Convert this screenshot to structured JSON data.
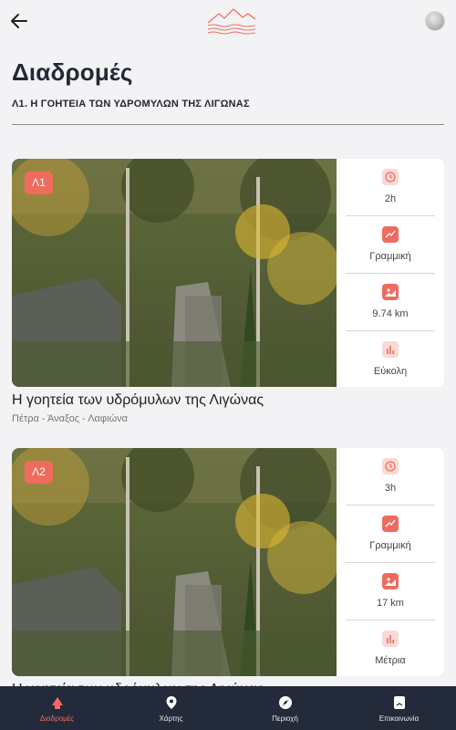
{
  "header": {
    "title": "Διαδρομές",
    "subtitle": "Λ1. Η ΓΟΗΤΕΙΑ ΤΩΝ ΥΔΡΟΜΥΛΩΝ ΤΗΣ ΛΙΓΩΝΑΣ"
  },
  "routes": [
    {
      "badge": "Λ1",
      "title": "Η γοητεία των υδρόμυλων της Λιγώνας",
      "places": "Πέτρα - Άναξος - Λαφιώνα",
      "stats": [
        {
          "icon": "clock-icon",
          "value": "2h"
        },
        {
          "icon": "trend-icon",
          "value": "Γραμμική"
        },
        {
          "icon": "image-icon",
          "value": "9.74 km"
        },
        {
          "icon": "chart-icon",
          "value": "Εύκολη"
        }
      ]
    },
    {
      "badge": "Λ2",
      "title": "Η γοητεία των υδρόμυλων της Λιγώνας",
      "places": "",
      "stats": [
        {
          "icon": "clock-icon",
          "value": "3h"
        },
        {
          "icon": "trend-icon",
          "value": "Γραμμική"
        },
        {
          "icon": "image-icon",
          "value": "17 km"
        },
        {
          "icon": "chart-icon",
          "value": "Μέτρια"
        }
      ]
    }
  ],
  "nav": [
    {
      "label": "Διαδρομές",
      "icon": "routes-icon",
      "active": true
    },
    {
      "label": "Χάρτης",
      "icon": "map-pin-icon",
      "active": false
    },
    {
      "label": "Περιοχή",
      "icon": "compass-icon",
      "active": false
    },
    {
      "label": "Επικοινωνία",
      "icon": "contact-icon",
      "active": false
    }
  ],
  "colors": {
    "accent": "#f06b5d",
    "nav_bg": "#232a3a",
    "icon_bg": "#fbd9d4"
  }
}
